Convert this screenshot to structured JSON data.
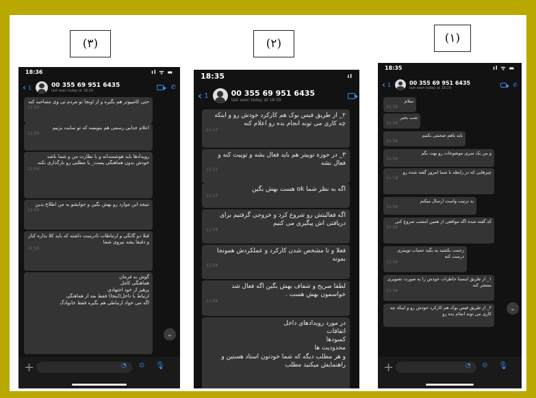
{
  "labels": {
    "one": "(۱)",
    "two": "(۲)",
    "three": "(۳)"
  },
  "screens": {
    "s1": {
      "time": "18:35",
      "signal": "ıl ᯤ ▬",
      "back_count": "1",
      "contact": "00 355 69 951 6435",
      "subtitle": "last seen today at 18:29",
      "messages": [
        {
          "text": "سلام",
          "time": "11:59"
        },
        {
          "text": "شب بخیر",
          "time": "11:59"
        },
        {
          "text": "باید باهم صحبتی بکنیم",
          "time": "11:59"
        },
        {
          "text": "و من یک سری موضوعات رو بهت بگم",
          "time": "11:59"
        },
        {
          "text": "چیزهایی که در رابطه با شما امروز گفته شده رو",
          "time": "11:59"
        },
        {
          "text": "به ترتیب واست ارسال میکنم",
          "time": "11:59"
        },
        {
          "text": "که گفته شده اگه موافقی از همین امشب شروع کنی",
          "time": "11:59"
        },
        {
          "text": "زحمت بکشید یه    بگید حساب توییتری درست کنه",
          "time": "11:59"
        },
        {
          "text": "۱_ از طریق اینستا خاطرات خودش را به صورت تصویری منتشر کنه",
          "time": "11:59"
        },
        {
          "text": "۲_ از طریق فیس بوک هم کارکرد خودش رو و اینکه چه کاری می تونه انجام بده رو",
          "time": ""
        }
      ]
    },
    "s2": {
      "time": "18:35",
      "signal": "ıl",
      "back_count": "1",
      "contact": "00 355 69 951 6435",
      "subtitle": "last seen today at 18:29",
      "messages": [
        {
          "text": "۲_ از طریق فیس بوک هم کارکرد خودش رو و اینکه چه کاری می تونه انجام بده رو اعلام کنه",
          "time": "11:57"
        },
        {
          "text": "۳_ در حوزه توییتر هم باید فعال بشه و توییت کنه و فعال بشه",
          "time": "11:57"
        },
        {
          "text": "اگه به نظر شما ok هست بهش بگین",
          "time": "11:57"
        },
        {
          "text": "اگه فعالیتش رو شروع کرد و خروجی گرفتیم برای دریافتی اش پیگیری می کنیم",
          "time": "11:58"
        },
        {
          "text": "فعلا و تا مشخص شدن کارکرد و عملکردش همونجا بمونه",
          "time": "11:58"
        },
        {
          "text": "لطفا صریح و شفاف بهش بگین اگه فعال شد خواسمون بهش هست .",
          "time": "11:59"
        },
        {
          "text": "در مورد رویدادهای داخل\nاتفاقات\nکمبودها\nمحدودیت ها\nو هر مطلب دیگه که شما خودتون استاد هستین و راهنمایش میکنید مطلب",
          "time": ""
        }
      ]
    },
    "s3": {
      "time": "18:36",
      "signal": "ıl ᯤ ▬",
      "back_count": "1",
      "contact": "00 355 69 951 6435",
      "subtitle": "last seen today at 18:29",
      "messages": [
        {
          "text": "حتی کامپیوتر هم بگیره و از اونجا تو مردم تی وی مصاحبه کنه",
          "time": "11:59"
        },
        {
          "text": "اعلام جدایی رسمی هم بنویسه که تو سایت بزنیم",
          "time": "11:59"
        },
        {
          "text": "رویدادها باید هوشمندانه و با نظارت من و شما باشه\nخودش بدون هماهنگی پست_ یا مطلبی رو بارگذاری نکنه",
          "time": "11:59"
        },
        {
          "text": "نتیجه این موارد رو بهش بگین و جوابشو به من اطلاع بدین",
          "time": "11:59"
        },
        {
          "text": "قبلا دو گانگی و ارتباطات نادرست داشته که باید کلا بذاره کنار و دقیقا بشه نیروی شما",
          "time": "11:59"
        },
        {
          "text": "گوش به فرمان\nهماهنگی کامل\nپرهیز از خود اجتهادی\nارتباط با داخل(اینجا) فقط بعد از هماهنگی\nاگه می خواد ارتباطی هم بگیره فقط خانوادگ",
          "time": ""
        }
      ]
    }
  }
}
